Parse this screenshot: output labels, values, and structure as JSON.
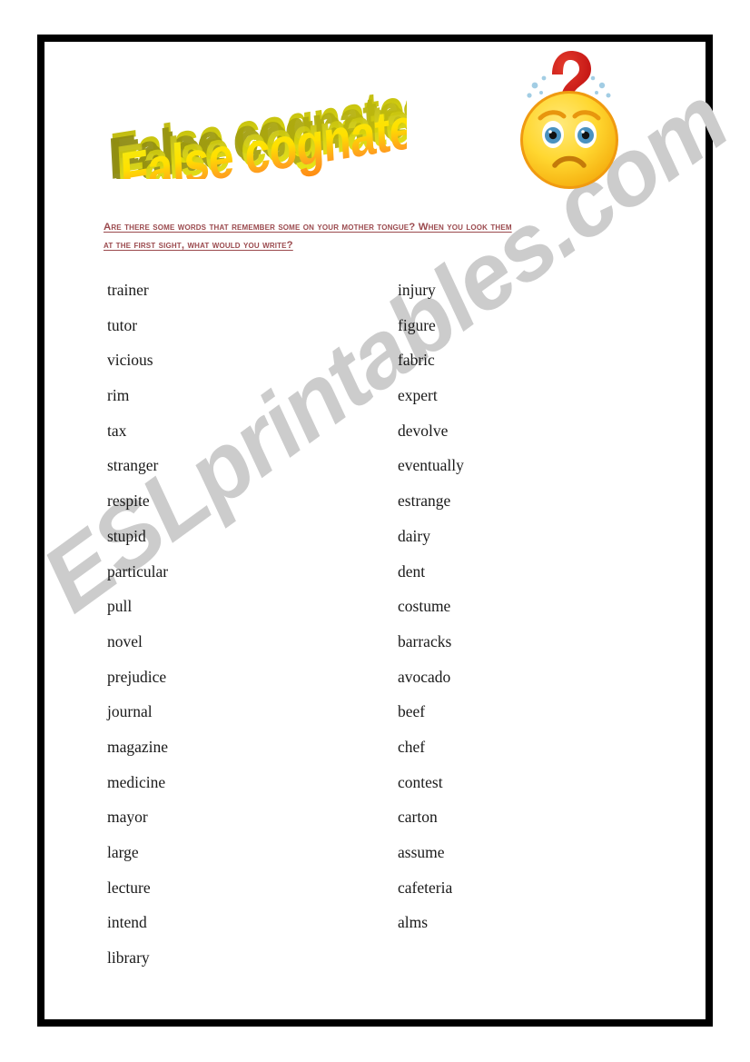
{
  "document": {
    "title_art": "False cognates?!",
    "border_color": "#000000",
    "page_background": "#ffffff"
  },
  "watermark": {
    "text": "ESLprintables.com",
    "color": "#cccccc"
  },
  "instruction": {
    "color": "#9b4a4e",
    "line1": "Are there some words that remember some on your mother tongue? When you look them",
    "line2": "at the first sight, what would you write?"
  },
  "smiley": {
    "name": "confused-question-smiley",
    "face_color": "#ffd630",
    "question_mark_color": "#cc1414",
    "sparkle_color": "#9ecbe3",
    "eye_color": "#4a92c0"
  },
  "word_lists": {
    "left": [
      "trainer",
      "tutor",
      "vicious",
      "rim",
      "tax",
      "stranger",
      "respite",
      "stupid",
      "particular",
      "pull",
      "novel",
      "prejudice",
      "journal",
      "magazine",
      "medicine",
      "mayor",
      "large",
      "lecture",
      "intend",
      "library"
    ],
    "right": [
      "injury",
      "figure",
      "fabric",
      "expert",
      "devolve",
      "eventually",
      "estrange",
      "dairy",
      "dent",
      "costume",
      "barracks",
      "avocado",
      "beef",
      "chef",
      "contest",
      "carton",
      "assume",
      "cafeteria",
      "alms"
    ]
  }
}
